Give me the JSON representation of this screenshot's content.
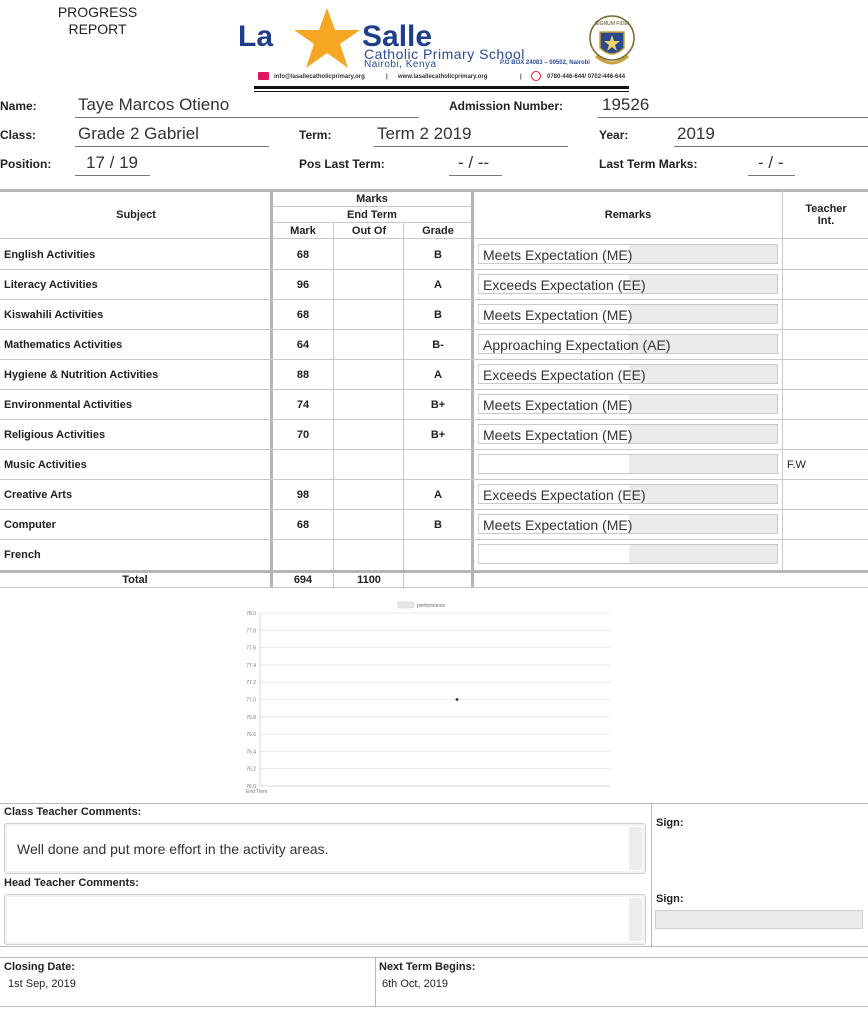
{
  "header": {
    "title_line1": "PROGRESS",
    "title_line2": "REPORT"
  },
  "logo": {
    "la": "La",
    "salle": "Salle",
    "school": "Catholic Primary School",
    "city": "Nairobi, Kenya",
    "box": "P.O BOX 24083 – 00502, Nairobi",
    "email": "info@lasallecatholicprimary.org",
    "website": "www.lasallecatholicprimary.org",
    "phone": "0780-446-644/ 0702-446-644",
    "crest_text": "SIGNUM FIDEI"
  },
  "student": {
    "name_label": "Name:",
    "name": "Taye Marcos Otieno",
    "admission_label": "Admission Number:",
    "admission": "19526",
    "class_label": "Class:",
    "class": "Grade 2 Gabriel",
    "term_label": "Term:",
    "term": "Term 2 2019",
    "year_label": "Year:",
    "year": "2019",
    "position_label": "Position:",
    "position": "17 / 19",
    "pos_last_term_label": "Pos Last Term:",
    "pos_last_term": "- / --",
    "last_term_marks_label": "Last Term Marks:",
    "last_term_marks": "- / -"
  },
  "table": {
    "subject_header": "Subject",
    "marks_header": "Marks",
    "end_term_header": "End Term",
    "mark_header": "Mark",
    "out_of_header": "Out Of",
    "grade_header": "Grade",
    "remarks_header": "Remarks",
    "teacher_int_header": "Teacher Int.",
    "rows": [
      {
        "subject": "English Activities",
        "mark": "68",
        "out_of": "",
        "grade": "B",
        "remark": "Meets Expectation (ME)",
        "teacher": ""
      },
      {
        "subject": "Literacy Activities",
        "mark": "96",
        "out_of": "",
        "grade": "A",
        "remark": "Exceeds Expectation (EE)",
        "teacher": ""
      },
      {
        "subject": "Kiswahili Activities",
        "mark": "68",
        "out_of": "",
        "grade": "B",
        "remark": "Meets Expectation (ME)",
        "teacher": ""
      },
      {
        "subject": "Mathematics Activities",
        "mark": "64",
        "out_of": "",
        "grade": "B-",
        "remark": "Approaching Expectation (AE)",
        "teacher": ""
      },
      {
        "subject": "Hygiene & Nutrition Activities",
        "mark": "88",
        "out_of": "",
        "grade": "A",
        "remark": "Exceeds Expectation (EE)",
        "teacher": ""
      },
      {
        "subject": "Environmental Activities",
        "mark": "74",
        "out_of": "",
        "grade": "B+",
        "remark": "Meets Expectation (ME)",
        "teacher": ""
      },
      {
        "subject": "Religious Activities",
        "mark": "70",
        "out_of": "",
        "grade": "B+",
        "remark": "Meets Expectation (ME)",
        "teacher": ""
      },
      {
        "subject": "Music Activities",
        "mark": "",
        "out_of": "",
        "grade": "",
        "remark": "",
        "teacher": "F.W"
      },
      {
        "subject": "Creative Arts",
        "mark": "98",
        "out_of": "",
        "grade": "A",
        "remark": "Exceeds Expectation (EE)",
        "teacher": ""
      },
      {
        "subject": "Computer",
        "mark": "68",
        "out_of": "",
        "grade": "B",
        "remark": "Meets Expectation (ME)",
        "teacher": ""
      },
      {
        "subject": "French",
        "mark": "",
        "out_of": "",
        "grade": "",
        "remark": "",
        "teacher": ""
      }
    ],
    "total_label": "Total",
    "total_mark": "694",
    "total_out_of": "1100"
  },
  "chart_data": {
    "type": "line",
    "legend": [
      "performance"
    ],
    "legend_position": "top",
    "categories": [
      "End Term"
    ],
    "series": [
      {
        "name": "performance",
        "values": [
          77.0
        ]
      }
    ],
    "ylim": [
      76.0,
      78.0
    ],
    "yticks": [
      "78.0",
      "77.8",
      "77.6",
      "77.4",
      "77.2",
      "77.0",
      "76.8",
      "76.6",
      "76.4",
      "76.2",
      "76.0"
    ],
    "point_x_label": "",
    "grid": true,
    "title": "",
    "xlabel": "",
    "ylabel": ""
  },
  "comments": {
    "class_teacher_label": "Class Teacher Comments:",
    "class_teacher_text": "Well done and put more effort in the activity areas.",
    "head_teacher_label": "Head Teacher Comments:",
    "head_teacher_text": "",
    "sign_label": "Sign:"
  },
  "dates": {
    "closing_label": "Closing Date:",
    "closing": "1st Sep, 2019",
    "next_term_label": "Next Term Begins:",
    "next_term": "6th Oct, 2019"
  },
  "colors": {
    "brand_blue": "#1f3f8c",
    "star_orange": "#f5a623",
    "box_grey": "#ebebeb"
  }
}
